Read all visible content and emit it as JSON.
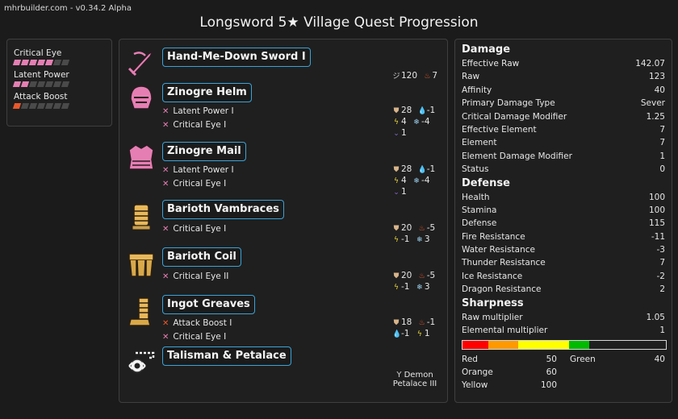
{
  "header": {
    "version": "mhrbuilder.com - v0.34.2 Alpha",
    "title": "Longsword 5★ Village Quest Progression"
  },
  "skills": [
    {
      "name": "Critical Eye",
      "level": 5,
      "max": 7,
      "color": "#e57fb3"
    },
    {
      "name": "Latent Power",
      "level": 2,
      "max": 7,
      "color": "#e57fb3"
    },
    {
      "name": "Attack Boost",
      "level": 1,
      "max": 7,
      "color": "#e8582c"
    }
  ],
  "equipment": {
    "weapon": {
      "name": "Hand-Me-Down Sword I",
      "sharpness": "120",
      "element": "7",
      "icon": "longsword-icon"
    },
    "helm": {
      "name": "Zinogre Helm",
      "decos": [
        "Latent Power I",
        "Critical Eye I"
      ],
      "defense": "28",
      "water": "-1",
      "thunder": "4",
      "ice": "-4",
      "dragon": "1",
      "icon": "helm-icon"
    },
    "mail": {
      "name": "Zinogre Mail",
      "decos": [
        "Latent Power I",
        "Critical Eye I"
      ],
      "defense": "28",
      "water": "-1",
      "thunder": "4",
      "ice": "-4",
      "dragon": "1",
      "icon": "chest-armor-icon"
    },
    "arms": {
      "name": "Barioth Vambraces",
      "decos": [
        "Critical Eye I"
      ],
      "defense": "20",
      "fire": "-5",
      "thunder": "-1",
      "ice": "3",
      "icon": "gauntlet-icon"
    },
    "waist": {
      "name": "Barioth Coil",
      "decos": [
        "Critical Eye II"
      ],
      "defense": "20",
      "fire": "-5",
      "thunder": "-1",
      "ice": "3",
      "icon": "waist-armor-icon"
    },
    "legs": {
      "name": "Ingot Greaves",
      "decos": [
        "Attack Boost I",
        "Critical Eye I"
      ],
      "defense": "18",
      "fire": "-1",
      "water": "-1",
      "thunder": "1",
      "icon": "greaves-icon"
    },
    "talisman": {
      "name": "Talisman & Petalace",
      "petalace_line1": "Demon",
      "petalace_line2": "Petalace III",
      "icon": "talisman-icon"
    }
  },
  "stats": {
    "damage_title": "Damage",
    "damage": [
      [
        "Effective Raw",
        "142.07"
      ],
      [
        "Raw",
        "123"
      ],
      [
        "Affinity",
        "40"
      ],
      [
        "Primary Damage Type",
        "Sever"
      ],
      [
        "Critical Damage Modifier",
        "1.25"
      ],
      [
        "Effective Element",
        "7"
      ],
      [
        "Element",
        "7"
      ],
      [
        "Element Damage Modifier",
        "1"
      ],
      [
        "Status",
        "0"
      ]
    ],
    "defense_title": "Defense",
    "defense": [
      [
        "Health",
        "100"
      ],
      [
        "Stamina",
        "100"
      ],
      [
        "Defense",
        "115"
      ],
      [
        "Fire Resistance",
        "-11"
      ],
      [
        "Water Resistance",
        "-3"
      ],
      [
        "Thunder Resistance",
        "7"
      ],
      [
        "Ice Resistance",
        "-2"
      ],
      [
        "Dragon Resistance",
        "2"
      ]
    ],
    "sharpness_title": "Sharpness",
    "sharpness": [
      [
        "Raw multiplier",
        "1.05"
      ],
      [
        "Elemental multiplier",
        "1"
      ]
    ],
    "sharpness_bar": [
      {
        "color": "#ff0000",
        "value": 50
      },
      {
        "color": "#ff9900",
        "value": 60
      },
      {
        "color": "#ffff00",
        "value": 100
      },
      {
        "color": "#00bb00",
        "value": 40
      }
    ],
    "sharpness_bar_max": 400,
    "sharpness_table": {
      "red_label": "Red",
      "red": "50",
      "orange_label": "Orange",
      "orange": "60",
      "yellow_label": "Yellow",
      "yellow": "100",
      "green_label": "Green",
      "green": "40"
    }
  }
}
